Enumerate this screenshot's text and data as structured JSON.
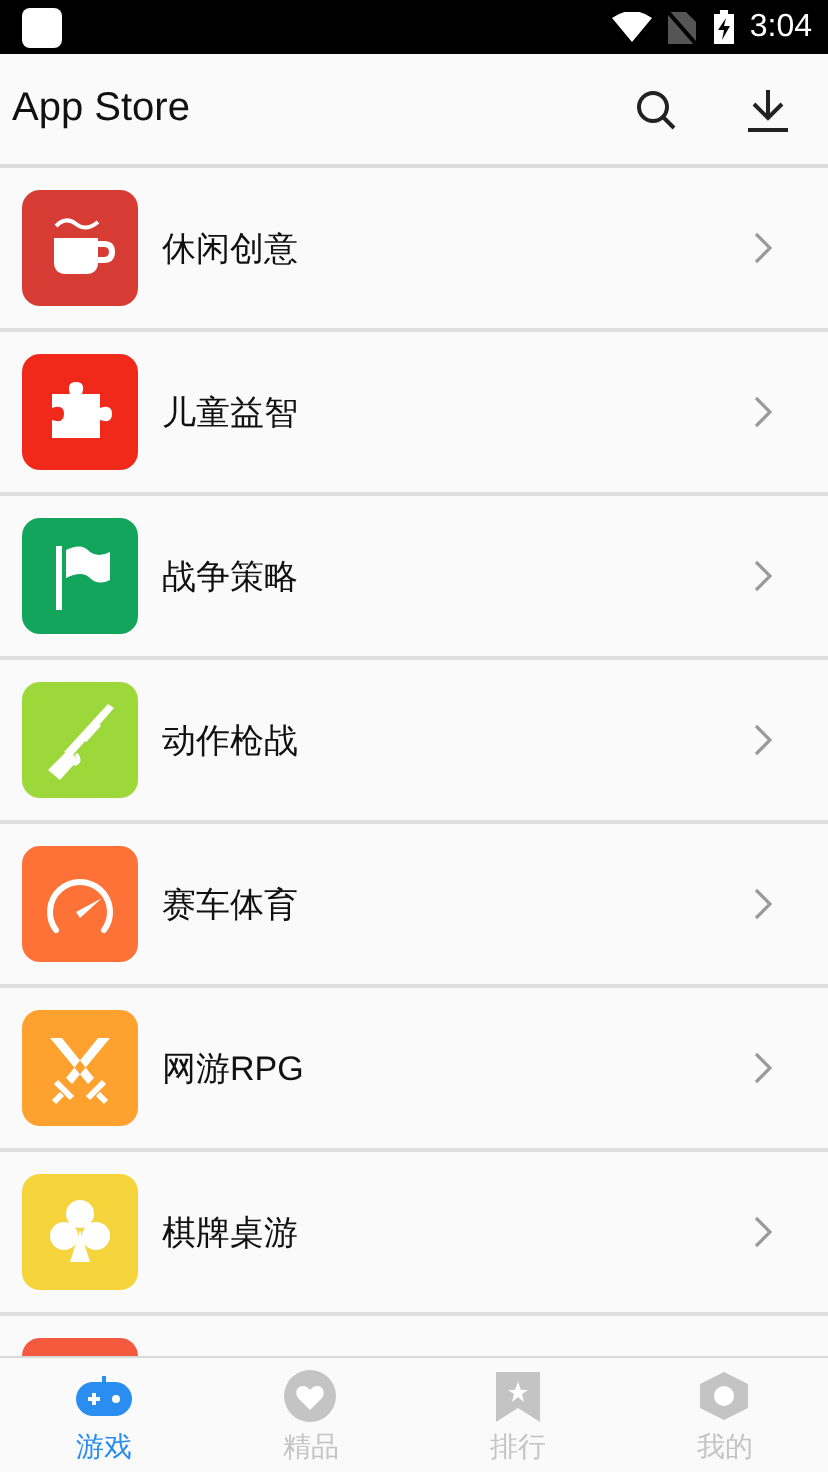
{
  "status_bar": {
    "time": "3:04"
  },
  "app_bar": {
    "title": "App Store"
  },
  "categories": [
    {
      "label": "休闲创意",
      "color": "#d63c33"
    },
    {
      "label": "儿童益智",
      "color": "#f0291a"
    },
    {
      "label": "战争策略",
      "color": "#13a55c"
    },
    {
      "label": "动作枪战",
      "color": "#9dd83a"
    },
    {
      "label": "赛车体育",
      "color": "#fe7238"
    },
    {
      "label": "网游RPG",
      "color": "#ffa12f"
    },
    {
      "label": "棋牌桌游",
      "color": "#f5d33a"
    },
    {
      "color": "#f65a3e"
    }
  ],
  "tabs": [
    {
      "label": "游戏",
      "selected": true
    },
    {
      "label": "精品",
      "selected": false
    },
    {
      "label": "排行",
      "selected": false
    },
    {
      "label": "我的",
      "selected": false
    }
  ]
}
